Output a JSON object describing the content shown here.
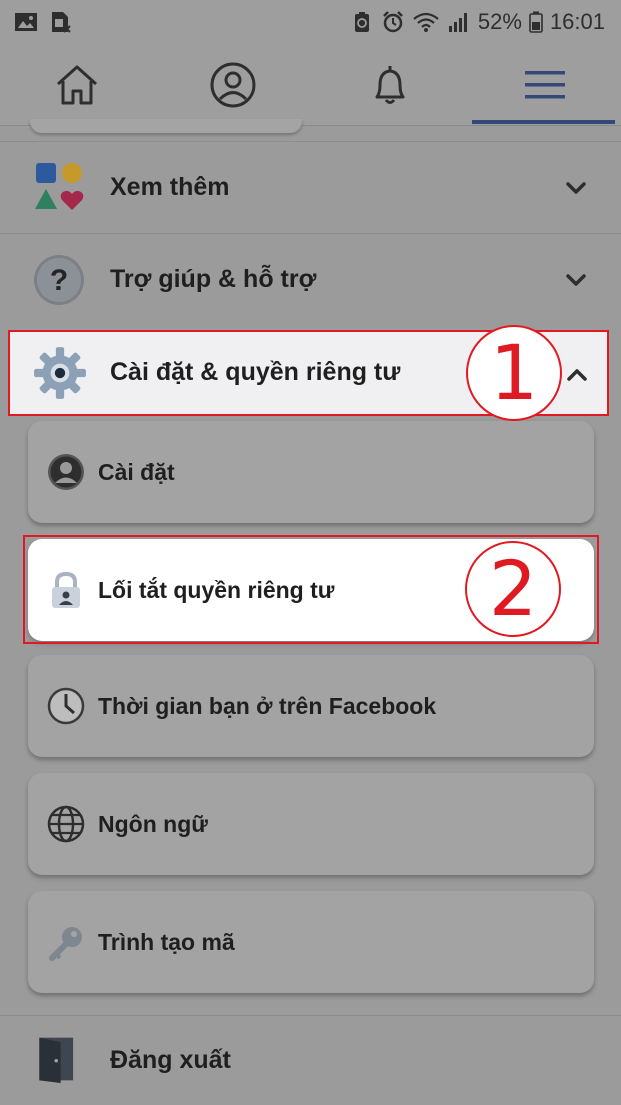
{
  "status_bar": {
    "battery_percent": "52%",
    "time": "16:01",
    "icons": [
      "gallery-icon",
      "sim-icon",
      "battery-saver-icon",
      "alarm-icon",
      "wifi-icon",
      "signal-icon",
      "battery-icon"
    ]
  },
  "nav": {
    "tabs": [
      {
        "name": "home",
        "icon": "home-icon"
      },
      {
        "name": "profile",
        "icon": "profile-icon"
      },
      {
        "name": "notifications",
        "icon": "bell-icon"
      },
      {
        "name": "menu",
        "icon": "menu-icon",
        "active": true
      }
    ],
    "active_color": "#35487a"
  },
  "sections": {
    "see_more": {
      "label": "Xem thêm",
      "icon": "shapes-icon"
    },
    "help": {
      "label": "Trợ giúp & hỗ trợ",
      "icon": "question-icon"
    },
    "settings_privacy": {
      "label": "Cài đặt & quyền riêng tư",
      "icon": "gear-icon",
      "expanded": true
    }
  },
  "submenu": [
    {
      "label": "Cài đặt",
      "icon": "user-circle-icon"
    },
    {
      "label": "Lối tắt quyền riêng tư",
      "icon": "lock-icon"
    },
    {
      "label": "Thời gian bạn ở trên Facebook",
      "icon": "clock-icon"
    },
    {
      "label": "Ngôn ngữ",
      "icon": "globe-icon"
    },
    {
      "label": "Trình tạo mã",
      "icon": "key-icon"
    }
  ],
  "logout": {
    "label": "Đăng xuất",
    "icon": "door-icon"
  },
  "annotations": {
    "step1": "1",
    "step2": "2",
    "color": "#e01a22"
  }
}
